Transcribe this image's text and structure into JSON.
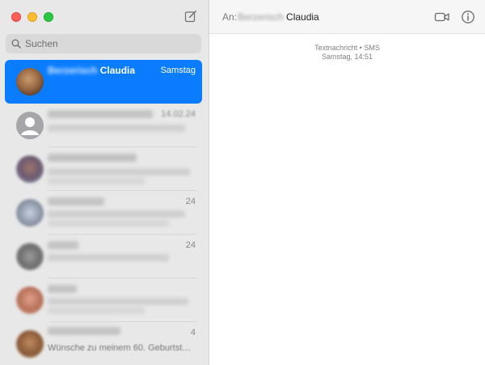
{
  "window": {
    "controls": [
      "close",
      "minimize",
      "zoom"
    ]
  },
  "sidebar": {
    "compose_icon": "compose-icon",
    "search": {
      "placeholder": "Suchen",
      "icon": "search-icon"
    },
    "conversations": [
      {
        "name_blurred": "Berzerisch",
        "name_visible": "Claudia",
        "time": "Samstag",
        "preview": "",
        "selected": true
      },
      {
        "name_blurred": "",
        "name_visible": "",
        "time": "14.02.24",
        "preview": "",
        "selected": false
      },
      {
        "name_blurred": "",
        "name_visible": "",
        "time": "",
        "preview": "",
        "selected": false
      },
      {
        "name_blurred": "",
        "name_visible": "",
        "time": "24",
        "preview": "",
        "selected": false
      },
      {
        "name_blurred": "",
        "name_visible": "",
        "time": "24",
        "preview": "",
        "selected": false
      },
      {
        "name_blurred": "",
        "name_visible": "",
        "time": "",
        "preview": "",
        "selected": false
      },
      {
        "name_blurred": "",
        "name_visible": "",
        "time": "4",
        "preview": "Wünsche zu meinem 60. Geburtstag...",
        "selected": false
      }
    ]
  },
  "header": {
    "to_label": "An:",
    "recipient_blurred": "Berzerisch",
    "recipient_name": "Claudia",
    "video_icon": "video-camera-icon",
    "info_icon": "info-icon"
  },
  "thread": {
    "service_label": "Textnachricht • SMS",
    "timestamp": "Samstag, 14:51"
  },
  "colors": {
    "accent": "#0a7cff",
    "sidebar_bg": "#e8e8e8",
    "close": "#fe5f57",
    "minimize": "#febc2e",
    "zoom": "#28c840"
  }
}
